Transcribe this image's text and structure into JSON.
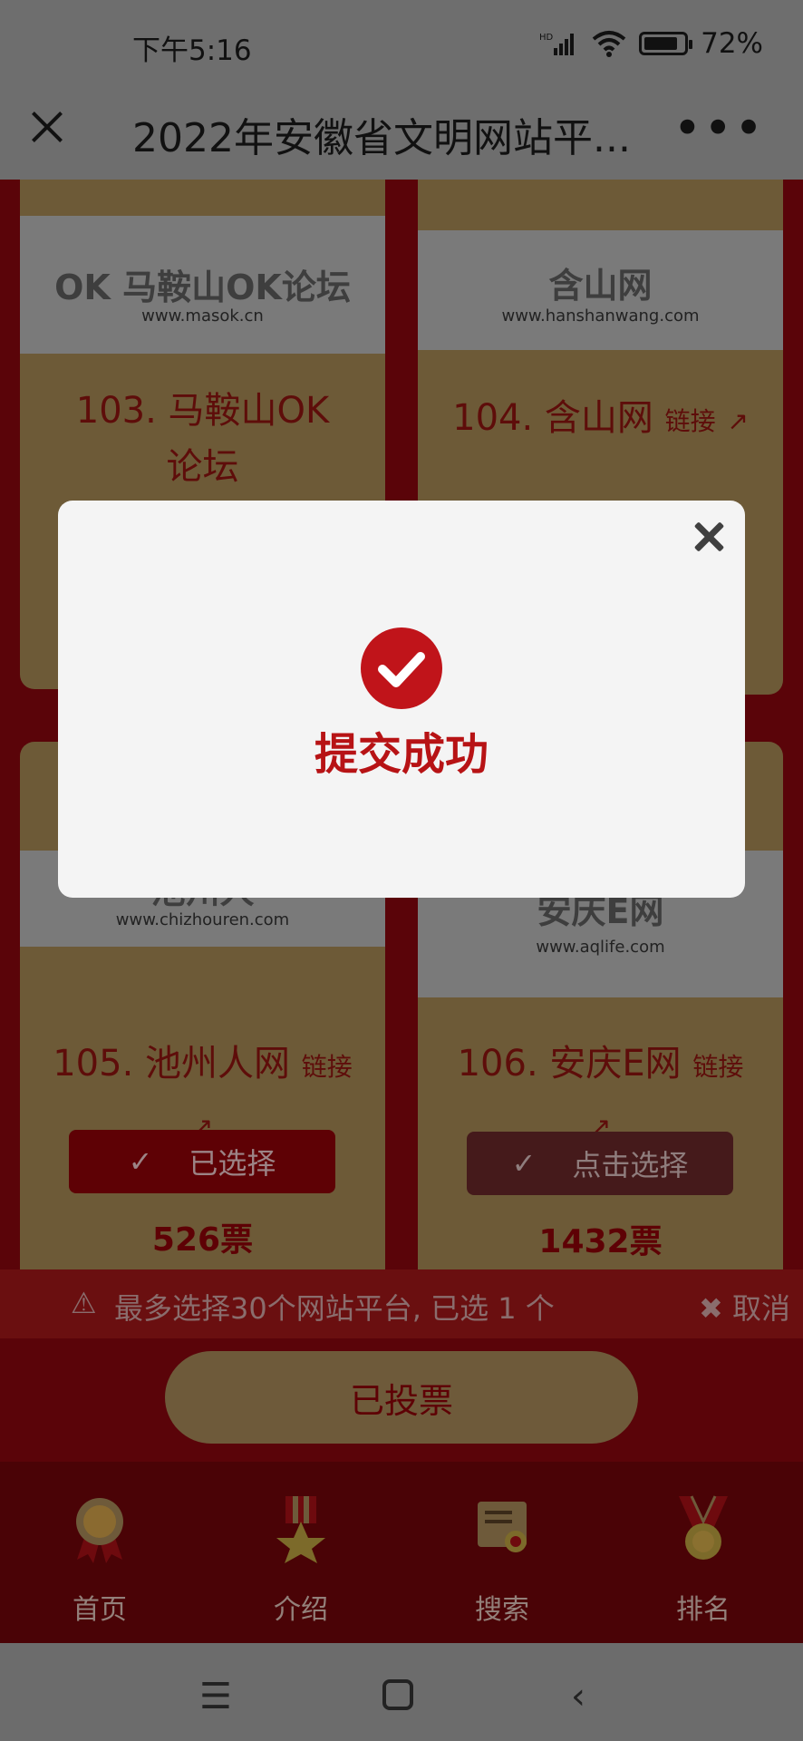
{
  "status": {
    "time": "下午5:16",
    "battery": "72%"
  },
  "titlebar": {
    "title": "2022年安徽省文明网站平..."
  },
  "cards": [
    {
      "number_name": "103. 马鞍山OK论坛",
      "logo_main": "OK 马鞍山OK论坛",
      "logo_url": "www.masok.cn"
    },
    {
      "number_name": "104. 含山网",
      "link_label": "链接",
      "logo_main": "含山网",
      "logo_url": "www.hanshanwang.com"
    },
    {
      "number_name": "105. 池州人网",
      "link_label": "链接",
      "logo_main": "池州人",
      "logo_url": "www.chizhouren.com",
      "button": "已选择",
      "votes": "526票"
    },
    {
      "number_name": "106. 安庆E网",
      "link_label": "链接",
      "logo_main": "安庆E网",
      "logo_url": "www.aqlife.com",
      "button": "点击选择",
      "votes": "1432票"
    }
  ],
  "notice": {
    "text": "最多选择30个网站平台, 已选 1 个",
    "cancel": "取消"
  },
  "voted_button": "已投票",
  "tabs": [
    {
      "label": "首页",
      "icon": "medal-icon"
    },
    {
      "label": "介绍",
      "icon": "star-award-icon"
    },
    {
      "label": "搜索",
      "icon": "certificate-icon"
    },
    {
      "label": "排名",
      "icon": "ranking-medal-icon"
    }
  ],
  "modal": {
    "message": "提交成功"
  },
  "colors": {
    "primary_red": "#c0141a",
    "gold": "#d7b075",
    "dim_overlay": "rgba(0,0,0,0.55)"
  }
}
